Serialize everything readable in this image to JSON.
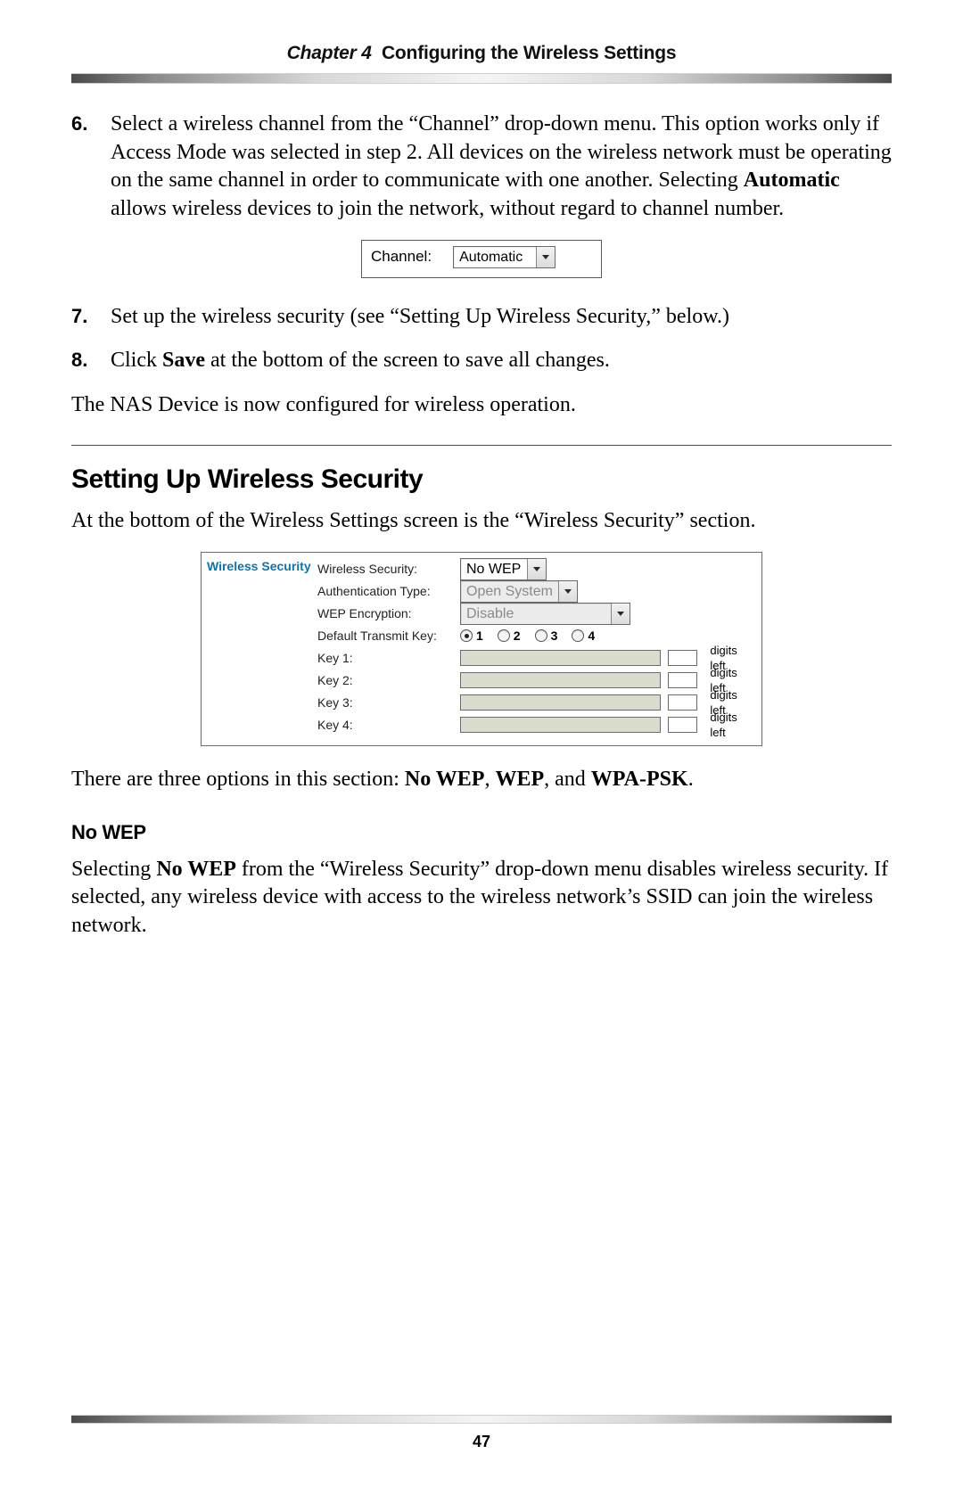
{
  "header": {
    "chapter_word": "Chapter 4",
    "title": "Configuring the Wireless Settings"
  },
  "steps": {
    "s6_num": "6.",
    "s6_a": "Select a wireless channel from the “Channel” drop-down menu. This option works only if Access Mode was selected in step 2. All devices on the wireless network must be operating on the same channel in order to communicate with one another. Selecting ",
    "s6_bold": "Automatic",
    "s6_b": " allows wireless devices to join the network, without regard to channel number.",
    "s7_num": "7.",
    "s7": "Set up the wireless security (see “Setting Up Wireless Security,” below.)",
    "s8_num": "8.",
    "s8_a": "Click ",
    "s8_bold": "Save",
    "s8_b": " at the bottom of the screen to save all changes."
  },
  "post_steps_a": "The ",
  "post_steps_nas": "NAS",
  "post_steps_b": " Device is now configured for wireless operation.",
  "channel_fig": {
    "label": "Channel:",
    "value": "Automatic"
  },
  "section_heading": "Setting Up Wireless Security",
  "section_intro": "At the bottom of the Wireless Settings screen is the “Wireless Security” section.",
  "sec_panel": {
    "title": "Wireless Security",
    "rows": {
      "wireless_security_label": "Wireless Security:",
      "wireless_security_value": "No WEP",
      "auth_label": "Authentication Type:",
      "auth_value": "Open System",
      "wep_label": "WEP Encryption:",
      "wep_value": "Disable",
      "default_key_label": "Default Transmit Key:",
      "radio1": "1",
      "radio2": "2",
      "radio3": "3",
      "radio4": "4",
      "key1_label": "Key 1:",
      "key2_label": "Key 2:",
      "key3_label": "Key 3:",
      "key4_label": "Key 4:",
      "digits_left": "digits left"
    }
  },
  "options_para_a": "There are three options in this section: ",
  "options_b1": "No WEP",
  "options_sep1": ", ",
  "options_b2": "WEP",
  "options_sep2": ", and ",
  "options_b3": "WPA-PSK",
  "options_end": ".",
  "nowep_heading": "No WEP",
  "nowep_para_a": "Selecting ",
  "nowep_bold": "No WEP",
  "nowep_para_b": " from the “Wireless Security” drop-down menu disables wireless security. If selected, any wireless device with access to the wireless network’s SSID can join the wireless network.",
  "page_number": "47"
}
